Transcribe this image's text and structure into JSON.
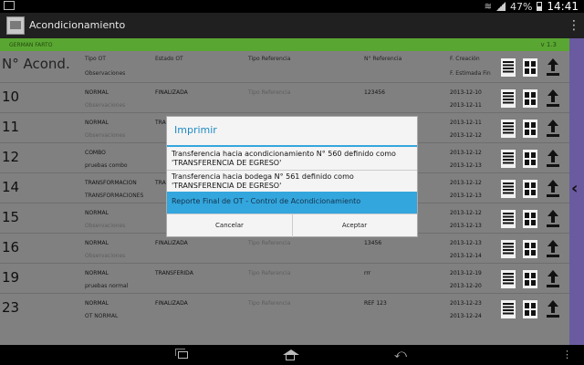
{
  "status_bar": {
    "battery": "47%",
    "time": "14:41"
  },
  "action_bar": {
    "title": "Acondicionamiento",
    "overflow_glyph": "⋮"
  },
  "green_bar": {
    "left": "GERMAN FARTO",
    "right": "v 1.3"
  },
  "table": {
    "headers": {
      "n_acond": "N° Acond.",
      "tipo_ot": "Tipo OT",
      "observaciones": "Observaciones",
      "estado_ot": "Estado OT",
      "tipo_referencia": "Tipo Referencia",
      "n_referencia": "N° Referencia",
      "f_creacion": "F. Creación",
      "f_estimada": "F. Estimada Fin"
    },
    "rows": [
      {
        "n": "10",
        "tipo": "NORMAL",
        "obs": "Observaciones",
        "obs_bright": false,
        "estado": "FINALIZADA",
        "tref": "Tipo Referencia",
        "nref": "123456",
        "fc": "2013-12-10",
        "fe": "2013-12-11"
      },
      {
        "n": "11",
        "tipo": "NORMAL",
        "obs": "Observaciones",
        "obs_bright": false,
        "estado": "TRA",
        "tref": "",
        "nref": "",
        "fc": "2013-12-11",
        "fe": "2013-12-12"
      },
      {
        "n": "12",
        "tipo": "COMBO",
        "obs": "pruebas combo",
        "obs_bright": true,
        "estado": "",
        "tref": "",
        "nref": "",
        "fc": "2013-12-12",
        "fe": "2013-12-13"
      },
      {
        "n": "14",
        "tipo": "TRANSFORMACION",
        "obs": "TRANSFORMACIONES",
        "obs_bright": true,
        "estado": "TRA",
        "tref": "",
        "nref": "",
        "fc": "2013-12-12",
        "fe": "2013-12-13"
      },
      {
        "n": "15",
        "tipo": "NORMAL",
        "obs": "Observaciones",
        "obs_bright": false,
        "estado": "",
        "tref": "",
        "nref": "",
        "fc": "2013-12-12",
        "fe": "2013-12-13"
      },
      {
        "n": "16",
        "tipo": "NORMAL",
        "obs": "Observaciones",
        "obs_bright": false,
        "estado": "FINALIZADA",
        "tref": "Tipo Referencia",
        "nref": "13456",
        "fc": "2013-12-13",
        "fe": "2013-12-14"
      },
      {
        "n": "19",
        "tipo": "NORMAL",
        "obs": "pruebas normal",
        "obs_bright": true,
        "estado": "TRANSFERIDA",
        "tref": "Tipo Referencia",
        "nref": "rrr",
        "fc": "2013-12-19",
        "fe": "2013-12-20"
      },
      {
        "n": "23",
        "tipo": "NORMAL",
        "obs": "OT NORMAL",
        "obs_bright": true,
        "estado": "FINALIZADA",
        "tref": "Tipo Referencia",
        "nref": "REF 123",
        "fc": "2013-12-23",
        "fe": "2013-12-24"
      }
    ]
  },
  "dialog": {
    "title": "Imprimir",
    "options": [
      {
        "line1": "Transferencia hacia acondicionamiento N° 560 definido como",
        "line2": "'TRANSFERENCIA DE EGRESO'"
      },
      {
        "line1": "Transferencia hacia bodega N° 561 definido como",
        "line2": "'TRANSFERENCIA DE EGRESO'"
      },
      {
        "line1": "Reporte Final de OT - Control de Acondicionamiento",
        "line2": ""
      }
    ],
    "cancel_label": "Cancelar",
    "accept_label": "Aceptar"
  },
  "right_strip": {
    "chevron": "‹"
  },
  "nav_bar": {
    "back_glyph": "⤺",
    "options_glyph": "⋮"
  }
}
